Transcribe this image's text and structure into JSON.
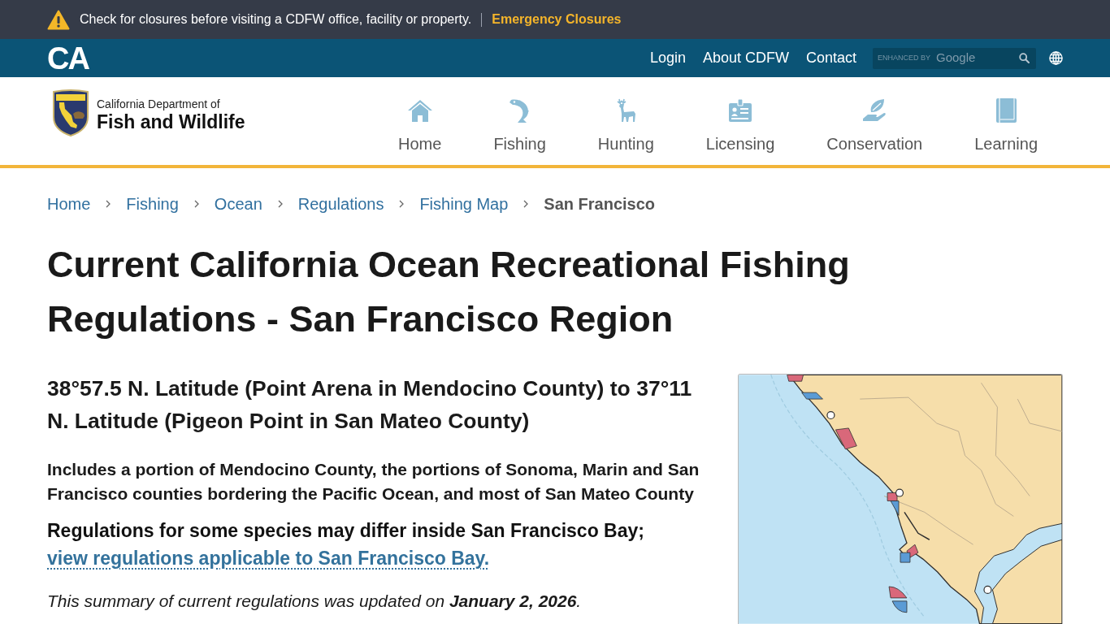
{
  "alert_bar": {
    "message": "Check for closures before visiting a CDFW office, facility or property.",
    "link": "Emergency Closures"
  },
  "utility_bar": {
    "logo": "CA",
    "links": [
      "Login",
      "About CDFW",
      "Contact"
    ],
    "search": {
      "branding_prefix": "ENHANCED BY",
      "branding": "Google"
    }
  },
  "header": {
    "department_line": "California Department of",
    "department_name": "Fish and Wildlife",
    "nav": [
      "Home",
      "Fishing",
      "Hunting",
      "Licensing",
      "Conservation",
      "Learning"
    ]
  },
  "breadcrumb": [
    {
      "label": "Home",
      "current": false
    },
    {
      "label": "Fishing",
      "current": false
    },
    {
      "label": "Ocean",
      "current": false
    },
    {
      "label": "Regulations",
      "current": false
    },
    {
      "label": "Fishing Map",
      "current": false
    },
    {
      "label": "San Francisco",
      "current": true
    }
  ],
  "page_title": "Current California Ocean Recreational Fishing Regulations - San Francisco Region",
  "content": {
    "subtitle": "38°57.5 N. Latitude (Point Arena in Mendocino County) to 37°11 N. Latitude (Pigeon Point in San Mateo County)",
    "coverage": "Includes a portion of Mendocino County, the portions of Sonoma, Marin and San Francisco counties bordering the Pacific Ocean, and most of San Mateo County",
    "bay_note": {
      "text": "Regulations for some species may differ inside San Francisco Bay;",
      "link": "view regulations applicable to San Francisco Bay."
    },
    "updated_note": "This summary of current regulations was updated on **January 2, 2026**."
  }
}
